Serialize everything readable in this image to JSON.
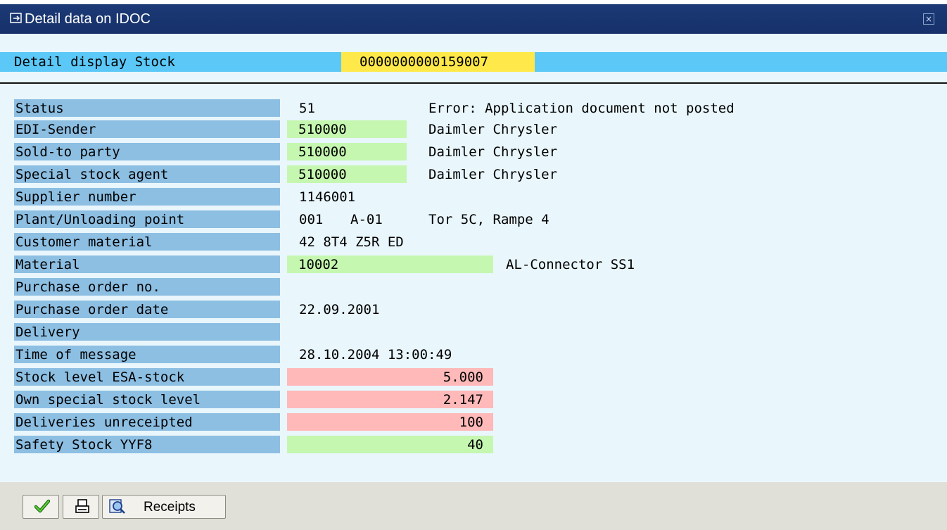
{
  "window": {
    "title": "Detail data on IDOC",
    "close_symbol": "×"
  },
  "header": {
    "label": "Detail display Stock",
    "idoc_number": "0000000000159007"
  },
  "rows": {
    "status": {
      "label": "Status",
      "code": "51",
      "text": "Error: Application document not posted"
    },
    "edi_sender": {
      "label": "EDI-Sender",
      "value": "510000",
      "text": "Daimler Chrysler"
    },
    "sold_to_party": {
      "label": "Sold-to party",
      "value": "510000",
      "text": "Daimler Chrysler"
    },
    "special_stock_agent": {
      "label": "Special stock agent",
      "value": "510000",
      "text": "Daimler Chrysler"
    },
    "supplier_number": {
      "label": "Supplier number",
      "value": "1146001"
    },
    "plant_unloading": {
      "label": "Plant/Unloading point",
      "plant": "001",
      "unloading": "A-01",
      "text": "Tor 5C, Rampe 4"
    },
    "customer_material": {
      "label": "Customer material",
      "value": "42 8T4 Z5R ED"
    },
    "material": {
      "label": "Material",
      "value": "10002",
      "text": "AL-Connector SS1"
    },
    "purchase_order_no": {
      "label": "Purchase order no.",
      "value": ""
    },
    "purchase_order_date": {
      "label": "Purchase order date",
      "value": "22.09.2001"
    },
    "delivery": {
      "label": "Delivery",
      "value": ""
    },
    "time_of_message": {
      "label": "Time of message",
      "value": "28.10.2004 13:00:49"
    },
    "stock_level_esa": {
      "label": "Stock level ESA-stock",
      "value": "5.000"
    },
    "own_special_stock": {
      "label": "Own special stock level",
      "value": "2.147"
    },
    "deliveries_unreceipted": {
      "label": "Deliveries unreceipted",
      "value": "100"
    },
    "safety_stock": {
      "label": "Safety Stock YYF8",
      "value": "40"
    }
  },
  "toolbar": {
    "confirm_icon": "checkmark-icon",
    "print_icon": "printer-icon",
    "receipts_icon": "magnifier-icon",
    "receipts_label": "Receipts"
  },
  "colors": {
    "title_bar": "#1c3a76",
    "header_strip": "#5bc8f7",
    "idoc_highlight": "#ffe94a",
    "label_column": "#8dbfe3",
    "content_bg": "#e9f6fc",
    "key_field": "#c5f7b0",
    "stock_field": "#ffb9b9",
    "toolbar_bg": "#e1e0d8"
  }
}
